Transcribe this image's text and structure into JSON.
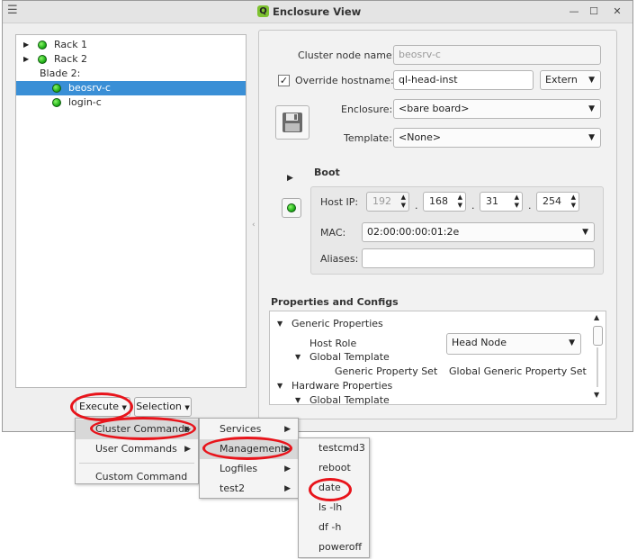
{
  "window": {
    "title": "Enclosure View",
    "icon_letter": "Q"
  },
  "tree": [
    {
      "label": "Rack 1",
      "has_arrow": true,
      "has_dot": true,
      "level": 0
    },
    {
      "label": "Rack 2",
      "has_arrow": true,
      "has_dot": true,
      "level": 0
    },
    {
      "label": "Blade 2:",
      "has_arrow": false,
      "has_dot": false,
      "level": 0
    },
    {
      "label": "beosrv-c",
      "has_arrow": false,
      "has_dot": true,
      "level": 1,
      "selected": true
    },
    {
      "label": "login-c",
      "has_arrow": false,
      "has_dot": true,
      "level": 1
    }
  ],
  "form": {
    "cluster_node_name_label": "Cluster node name:",
    "cluster_node_name_value": "beosrv-c",
    "override_hostname_label": "Override hostname:",
    "override_checked": true,
    "override_value": "ql-head-inst",
    "extern_value": "Extern",
    "enclosure_label": "Enclosure:",
    "enclosure_value": "<bare board>",
    "template_label": "Template:",
    "template_value": "<None>"
  },
  "boot": {
    "heading": "Boot",
    "host_ip_label": "Host IP:",
    "ip": [
      "192",
      "168",
      "31",
      "254"
    ],
    "ip_sep": ".",
    "mac_label": "MAC:",
    "mac_value": "02:00:00:00:01:2e",
    "aliases_label": "Aliases:",
    "aliases_value": ""
  },
  "properties": {
    "heading": "Properties and Configs",
    "rows": [
      {
        "label": "Generic Properties",
        "value": "",
        "indent": 0,
        "expanded": true
      },
      {
        "label": "Host Role",
        "value": "Head Node",
        "indent": 1,
        "combo": true
      },
      {
        "label": "Global Template",
        "value": "",
        "indent": 1,
        "expanded": true
      },
      {
        "label": "Generic Property Set",
        "value": "Global Generic Property Set",
        "indent": 2
      },
      {
        "label": "Hardware Properties",
        "value": "",
        "indent": 0,
        "expanded": true
      },
      {
        "label": "Global Template",
        "value": "",
        "indent": 1,
        "expanded": true
      }
    ]
  },
  "buttons": {
    "execute": "Execute",
    "selection": "Selection"
  },
  "menu1": {
    "items": [
      {
        "label": "Cluster Commands",
        "submenu": true,
        "highlight": true
      },
      {
        "label": "User Commands",
        "submenu": true
      },
      {
        "label": "Custom Command",
        "submenu": false,
        "sep_before": true
      }
    ]
  },
  "menu2": {
    "items": [
      {
        "label": "Services",
        "submenu": true
      },
      {
        "label": "Management",
        "submenu": true,
        "highlight": true
      },
      {
        "label": "Logfiles",
        "submenu": true
      },
      {
        "label": "test2",
        "submenu": true
      }
    ]
  },
  "menu3": {
    "items": [
      {
        "label": "testcmd3"
      },
      {
        "label": "reboot"
      },
      {
        "label": "date"
      },
      {
        "label": "ls -lh"
      },
      {
        "label": "df -h"
      },
      {
        "label": "poweroff"
      }
    ]
  },
  "colors": {
    "highlight_ring": "#e8141b",
    "selection": "#3a8fd6",
    "status_green": "#22b31a"
  }
}
